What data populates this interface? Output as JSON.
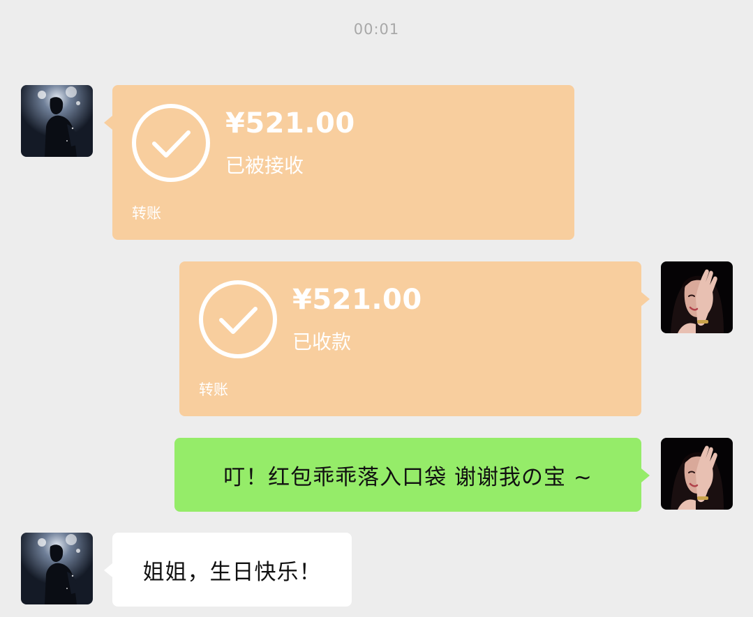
{
  "chat": {
    "timestamp": "00:01",
    "messages": [
      {
        "sender": "boy",
        "type": "transfer",
        "amount": "¥521.00",
        "status": "已被接收",
        "label": "转账",
        "color": "#f8ce9e"
      },
      {
        "sender": "girl",
        "type": "transfer",
        "amount": "¥521.00",
        "status": "已收款",
        "label": "转账",
        "color": "#f8ce9e"
      },
      {
        "sender": "girl",
        "type": "text",
        "text": "叮！红包乖乖落入口袋 谢谢我の宝 ~",
        "color": "#95ec69"
      },
      {
        "sender": "boy",
        "type": "text",
        "text": "姐姐，生日快乐！",
        "color": "#ffffff"
      }
    ]
  },
  "icons": {
    "transfer_status": "check-circle-icon",
    "avatar_boy": "avatar-boy",
    "avatar_girl": "avatar-girl"
  },
  "colors": {
    "background": "#ededed",
    "timestamp": "#a8a8a8",
    "transfer_bubble": "#f8ce9e",
    "sent_bubble": "#95ec69",
    "received_bubble": "#ffffff"
  }
}
